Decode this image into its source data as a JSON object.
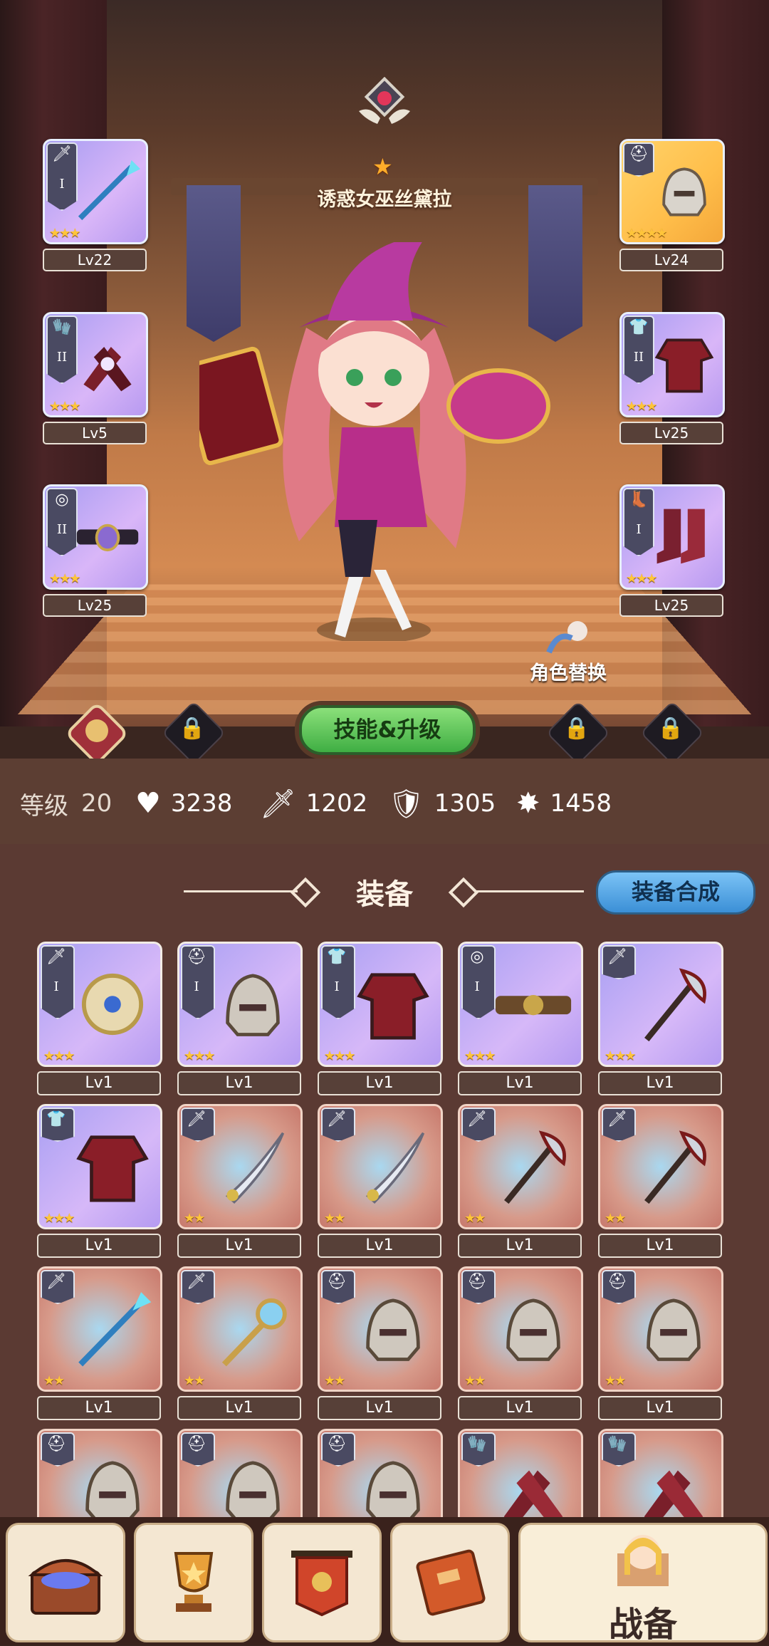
{
  "hero": {
    "name": "诱惑女巫丝黛拉",
    "stars": "★"
  },
  "equipped_left": [
    {
      "level": "Lv22",
      "stars": "★★★",
      "tier": "I",
      "symbol": "🗡",
      "icon": "spear-icon",
      "rarity": "purple"
    },
    {
      "level": "Lv5",
      "stars": "★★★",
      "tier": "II",
      "symbol": "🧤",
      "icon": "gauntlets-icon",
      "rarity": "purple"
    },
    {
      "level": "Lv25",
      "stars": "★★★",
      "tier": "II",
      "symbol": "◎",
      "icon": "belt-icon",
      "rarity": "purple"
    }
  ],
  "equipped_right": [
    {
      "level": "Lv24",
      "stars": "★★★★",
      "tier": "",
      "symbol": "⛑",
      "icon": "helmet-icon",
      "rarity": "gold"
    },
    {
      "level": "Lv25",
      "stars": "★★★",
      "tier": "II",
      "symbol": "👕",
      "icon": "armor-icon",
      "rarity": "purple"
    },
    {
      "level": "Lv25",
      "stars": "★★★",
      "tier": "I",
      "symbol": "👢",
      "icon": "boots-icon",
      "rarity": "purple"
    }
  ],
  "swap_label": "角色替换",
  "skill_button": "技能&升级",
  "stats": {
    "level_label": "等级",
    "level": "20",
    "hp": "3238",
    "attack": "1202",
    "defense": "1305",
    "crit": "1458"
  },
  "section_title": "装备",
  "synth_button": "装备合成",
  "inventory": [
    {
      "level": "Lv1",
      "stars": "★★★",
      "tier": "I",
      "symbol": "🗡",
      "icon": "shield-orb-icon",
      "rarity": "purple"
    },
    {
      "level": "Lv1",
      "stars": "★★★",
      "tier": "I",
      "symbol": "⛑",
      "icon": "helmet-icon",
      "rarity": "purple"
    },
    {
      "level": "Lv1",
      "stars": "★★★",
      "tier": "I",
      "symbol": "👕",
      "icon": "armor-icon",
      "rarity": "purple"
    },
    {
      "level": "Lv1",
      "stars": "★★★",
      "tier": "I",
      "symbol": "◎",
      "icon": "belt-icon",
      "rarity": "purple"
    },
    {
      "level": "Lv1",
      "stars": "★★★",
      "tier": "",
      "symbol": "🗡",
      "icon": "axe-icon",
      "rarity": "purple"
    },
    {
      "level": "Lv1",
      "stars": "★★★",
      "tier": "",
      "symbol": "👕",
      "icon": "armor-icon",
      "rarity": "purple"
    },
    {
      "level": "Lv1",
      "stars": "★★",
      "tier": "",
      "symbol": "🗡",
      "icon": "sword-icon",
      "rarity": "red"
    },
    {
      "level": "Lv1",
      "stars": "★★",
      "tier": "",
      "symbol": "🗡",
      "icon": "sword-icon",
      "rarity": "red"
    },
    {
      "level": "Lv1",
      "stars": "★★",
      "tier": "",
      "symbol": "🗡",
      "icon": "axe-icon",
      "rarity": "red"
    },
    {
      "level": "Lv1",
      "stars": "★★",
      "tier": "",
      "symbol": "🗡",
      "icon": "axe-icon",
      "rarity": "red"
    },
    {
      "level": "Lv1",
      "stars": "★★",
      "tier": "",
      "symbol": "🗡",
      "icon": "spear-icon",
      "rarity": "red"
    },
    {
      "level": "Lv1",
      "stars": "★★",
      "tier": "",
      "symbol": "🗡",
      "icon": "staff-icon",
      "rarity": "red"
    },
    {
      "level": "Lv1",
      "stars": "★★",
      "tier": "",
      "symbol": "⛑",
      "icon": "helmet-icon",
      "rarity": "red"
    },
    {
      "level": "Lv1",
      "stars": "★★",
      "tier": "",
      "symbol": "⛑",
      "icon": "helmet-icon",
      "rarity": "red"
    },
    {
      "level": "Lv1",
      "stars": "★★",
      "tier": "",
      "symbol": "⛑",
      "icon": "helmet-icon",
      "rarity": "red"
    },
    {
      "level": "",
      "stars": "",
      "tier": "",
      "symbol": "⛑",
      "icon": "helmet-icon",
      "rarity": "red"
    },
    {
      "level": "",
      "stars": "",
      "tier": "",
      "symbol": "⛑",
      "icon": "helmet-icon",
      "rarity": "red"
    },
    {
      "level": "",
      "stars": "",
      "tier": "",
      "symbol": "⛑",
      "icon": "helmet-icon",
      "rarity": "red"
    },
    {
      "level": "",
      "stars": "",
      "tier": "",
      "symbol": "🧤",
      "icon": "gauntlets-icon",
      "rarity": "red"
    },
    {
      "level": "",
      "stars": "",
      "tier": "",
      "symbol": "🧤",
      "icon": "gauntlets-icon",
      "rarity": "red"
    }
  ],
  "nav": {
    "items": [
      {
        "icon": "treasure-chest-icon"
      },
      {
        "icon": "trophy-icon"
      },
      {
        "icon": "banner-icon"
      },
      {
        "icon": "book-icon"
      }
    ],
    "active_label": "战备"
  }
}
